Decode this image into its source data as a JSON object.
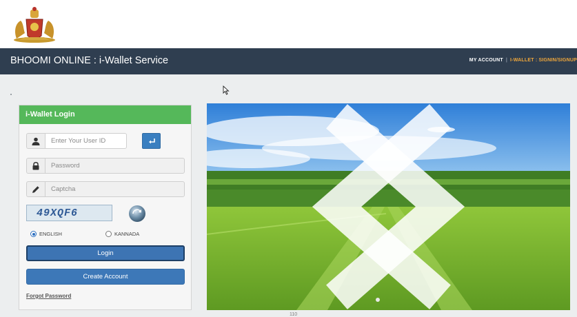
{
  "header": {
    "emblem_icon": "karnataka-state-emblem-icon",
    "brand": "BHOOMI ONLINE : i-Wallet Service",
    "links": {
      "my_account": "MY ACCOUNT",
      "separator": "|",
      "wallet_signin": "I-WALLET : SIGNIN/SIGNUP"
    },
    "colors": {
      "navbar": "#2f3e50",
      "wallet_link": "#f0a73a"
    }
  },
  "login": {
    "title": "i-Wallet Login",
    "header_color": "#55b85a",
    "user_id": {
      "value": "",
      "placeholder": "Enter Your User ID",
      "icon": "user-icon"
    },
    "go_button_icon": "enter-arrow-icon",
    "password": {
      "value": "",
      "placeholder": "Password",
      "icon": "lock-icon"
    },
    "captcha_field": {
      "value": "",
      "placeholder": "Captcha",
      "icon": "pencil-icon"
    },
    "captcha_text": "49XQF6",
    "refresh_icon": "refresh-captcha-icon",
    "languages": [
      {
        "label": "ENGLISH",
        "selected": true
      },
      {
        "label": "KANNADA",
        "selected": false
      }
    ],
    "login_label": "Login",
    "create_label": "Create Account",
    "forgot_label": "Forgot Password",
    "button_color": "#3d74b3"
  },
  "carousel": {
    "image": "green-wheat-field-landscape",
    "prev_icon": "chevron-left-icon",
    "next_icon": "chevron-right-icon",
    "indicator_count": 1
  },
  "footer": {
    "partial_text": "110"
  }
}
